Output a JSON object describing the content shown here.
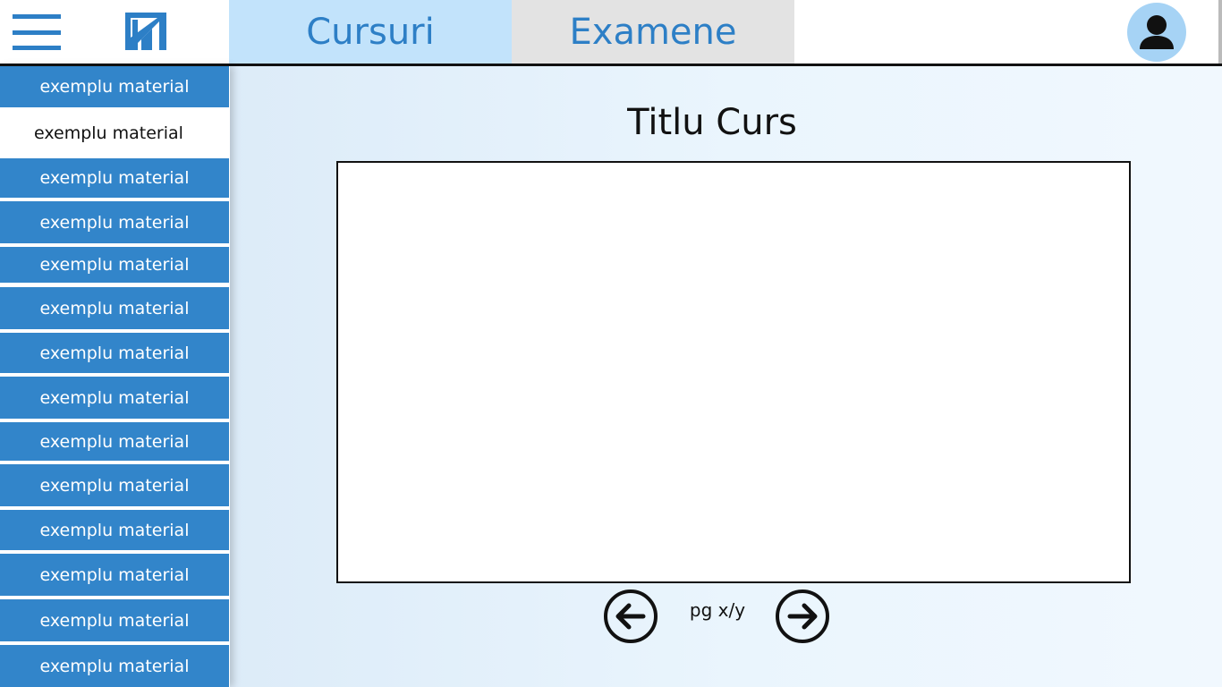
{
  "header": {
    "menu_icon": "hamburger-menu-icon",
    "logo_icon": "fmi-logo-icon",
    "tabs": [
      {
        "label": "Cursuri",
        "selected": true
      },
      {
        "label": "Examene",
        "selected": false
      }
    ],
    "avatar_icon": "user-avatar-icon"
  },
  "sidebar": {
    "items": [
      {
        "label": "exemplu material"
      },
      {
        "label": "exemplu material",
        "active": true
      },
      {
        "label": "exemplu material"
      },
      {
        "label": "exemplu material"
      },
      {
        "label": "exemplu material"
      },
      {
        "label": "exemplu material"
      },
      {
        "label": "exemplu material"
      },
      {
        "label": "exemplu material"
      },
      {
        "label": "exemplu material"
      },
      {
        "label": "exemplu material"
      },
      {
        "label": "exemplu material"
      },
      {
        "label": "exemplu material"
      },
      {
        "label": "exemplu material"
      },
      {
        "label": "exemplu material"
      }
    ]
  },
  "main": {
    "title": "Titlu Curs",
    "pager": {
      "indicator": "pg x/y",
      "prev_icon": "arrow-left-circle-icon",
      "next_icon": "arrow-right-circle-icon"
    }
  },
  "colors": {
    "accent": "#3285ca",
    "tab_selected_bg": "#c2e3fb",
    "tab_unselected_bg": "#e3e3e3",
    "avatar_bg": "#a6d3f5"
  }
}
